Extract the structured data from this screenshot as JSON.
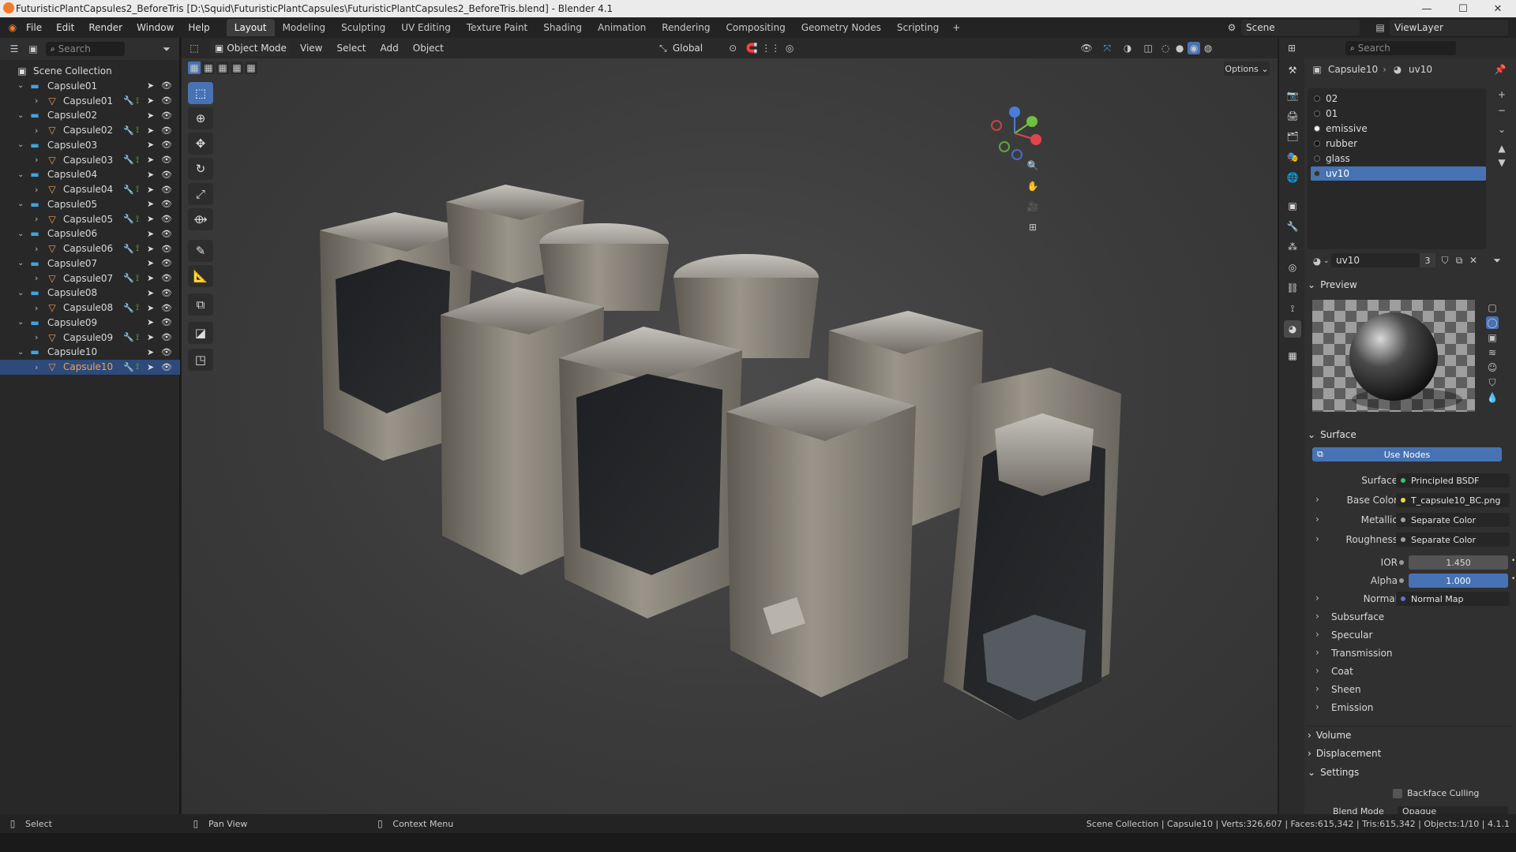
{
  "window": {
    "title": "FuturisticPlantCapsules2_BeforeTris [D:\\Squid\\FuturisticPlantCapsules\\FuturisticPlantCapsules2_BeforeTris.blend] - Blender 4.1"
  },
  "menu": [
    "File",
    "Edit",
    "Render",
    "Window",
    "Help"
  ],
  "workspaces": [
    "Layout",
    "Modeling",
    "Sculpting",
    "UV Editing",
    "Texture Paint",
    "Shading",
    "Animation",
    "Rendering",
    "Compositing",
    "Geometry Nodes",
    "Scripting"
  ],
  "scene": {
    "name": "Scene",
    "view_layer": "ViewLayer"
  },
  "outliner": {
    "search_placeholder": "Search",
    "root": "Scene Collection",
    "items": [
      {
        "collection": "Capsule01",
        "object": "Capsule01"
      },
      {
        "collection": "Capsule02",
        "object": "Capsule02"
      },
      {
        "collection": "Capsule03",
        "object": "Capsule03"
      },
      {
        "collection": "Capsule04",
        "object": "Capsule04"
      },
      {
        "collection": "Capsule05",
        "object": "Capsule05"
      },
      {
        "collection": "Capsule06",
        "object": "Capsule06"
      },
      {
        "collection": "Capsule07",
        "object": "Capsule07"
      },
      {
        "collection": "Capsule08",
        "object": "Capsule08"
      },
      {
        "collection": "Capsule09",
        "object": "Capsule09"
      },
      {
        "collection": "Capsule10",
        "object": "Capsule10"
      }
    ]
  },
  "viewport": {
    "mode": "Object Mode",
    "menus": [
      "View",
      "Select",
      "Add",
      "Object"
    ],
    "orientation": "Global",
    "options": "Options"
  },
  "properties": {
    "search_placeholder": "Search",
    "breadcrumb": {
      "object": "Capsule10",
      "material": "uv10"
    },
    "slots": [
      "02",
      "01",
      "emissive",
      "rubber",
      "glass",
      "uv10"
    ],
    "selected_slot": "uv10",
    "material_name": "uv10",
    "user_count": "3",
    "panels": {
      "preview": "Preview",
      "surface": "Surface",
      "volume": "Volume",
      "displacement": "Displacement",
      "settings": "Settings"
    },
    "use_nodes": "Use Nodes",
    "surface_rows": [
      {
        "label": "Surface",
        "value": "Principled BSDF",
        "dot": "#3dbf6c",
        "expand": false
      },
      {
        "label": "Base Color",
        "value": "T_capsule10_BC.png",
        "dot": "#e8d84a",
        "expand": true
      },
      {
        "label": "Metallic",
        "value": "Separate Color",
        "dot": "#a0a0a0",
        "expand": true
      },
      {
        "label": "Roughness",
        "value": "Separate Color",
        "dot": "#a0a0a0",
        "expand": true
      }
    ],
    "ior": {
      "label": "IOR",
      "value": "1.450"
    },
    "alpha": {
      "label": "Alpha",
      "value": "1.000"
    },
    "normal": {
      "label": "Normal",
      "value": "Normal Map",
      "dot": "#6a6ad8"
    },
    "subpanels": [
      "Subsurface",
      "Specular",
      "Transmission",
      "Coat",
      "Sheen",
      "Emission"
    ],
    "backface_culling": "Backface Culling",
    "blend_mode": {
      "label": "Blend Mode",
      "value": "Opaque"
    }
  },
  "status_bar": {
    "select": "Select",
    "pan_view": "Pan View",
    "context_menu": "Context Menu",
    "stats": "Scene Collection | Capsule10 | Verts:326,607 | Faces:615,342 | Tris:615,342 | Objects:1/10 | 4.1.1"
  },
  "colors": {
    "accent": "#4772b3",
    "selection": "#2d4a7a",
    "collection": "#3ea4e0",
    "mesh": "#f0a050"
  }
}
